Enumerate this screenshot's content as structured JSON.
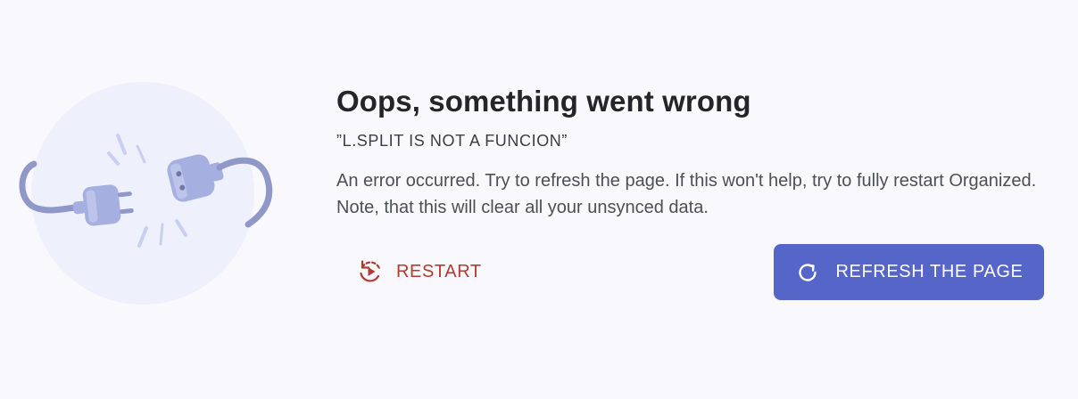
{
  "error": {
    "title": "Oops, something went wrong",
    "code": "”L.SPLIT IS NOT A FUNCION”",
    "description": "An error occurred. Try to refresh the page. If this won't help, try to fully restart Organized. Note, that this will clear all your unsynced data."
  },
  "actions": {
    "restart_label": "RESTART",
    "restart_icon": "restart-icon",
    "refresh_label": "REFRESH THE PAGE",
    "refresh_icon": "refresh-icon"
  },
  "illustration": {
    "icon": "unplugged-icon"
  },
  "colors": {
    "background": "#f8f8fd",
    "accent": "#5566c8",
    "danger": "#b33a2e",
    "title": "#24242a",
    "text": "#4e4e56"
  }
}
